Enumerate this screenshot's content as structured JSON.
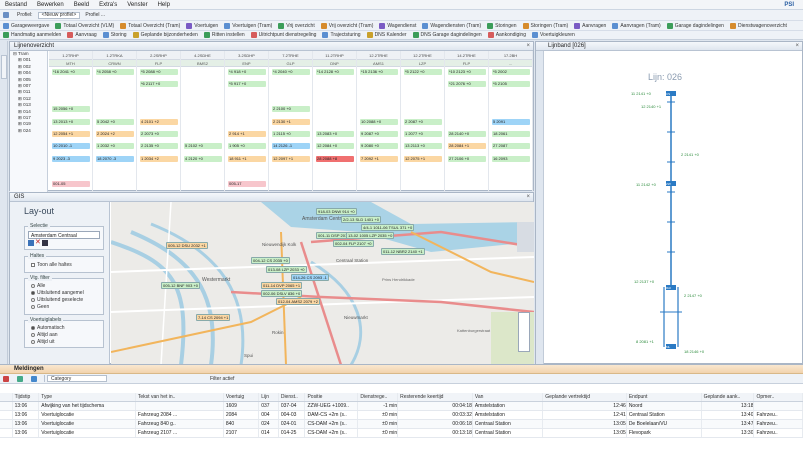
{
  "menu": {
    "items": [
      "Bestand",
      "Bewerken",
      "Beeld",
      "Extra's",
      "Venster",
      "Help"
    ],
    "brand": "PSI"
  },
  "toolbar1": {
    "profiel_label": "Profiel:",
    "profiel_value": "<Nieuw profiel>",
    "profiel2": "Profiel ..."
  },
  "toolbar2": [
    "Garageweergave",
    "Totaal Overzicht (VLM)",
    "Totaal Overzicht (Tram)",
    "Voertuigen",
    "Voertuigen (Tram)",
    "Vrij overzicht",
    "Vrij overzicht (Tram)",
    "Wagendienst",
    "Wagendiensten (Tram)",
    "Storingen",
    "Storingen (Tram)",
    "Aanvragen",
    "Aanvragen (Tram)",
    "Garage dagindelingen",
    "Dienstwagenoverzicht"
  ],
  "toolbar3": [
    "Handmatig aanmelden",
    "Aanvraag",
    "Storing",
    "Geplande bijzonderheden",
    "Ritten instellen",
    "Uitrichtpunt dienstregeling",
    "Trajectsturing",
    "DNS Kalender",
    "DNS Garage dagindelingen",
    "Aankondiging",
    "Voertuigkleuren"
  ],
  "lijnen": {
    "title": "Lijnenoverzicht",
    "tree": [
      "Tram",
      "001",
      "002",
      "004",
      "005",
      "007",
      "011",
      "012",
      "013",
      "014",
      "017",
      "019",
      "024"
    ],
    "columns": [
      {
        "head": "1.2TRHP",
        "sub": "MTH"
      },
      {
        "head": "1.2TRKA",
        "sub": "CRWN"
      },
      {
        "head": "2.2SRHP",
        "sub": "FLP"
      },
      {
        "head": "4.2SDHE",
        "sub": "BMS2"
      },
      {
        "head": "3.2SDHP",
        "sub": "ENP"
      },
      {
        "head": "7.2TRHE",
        "sub": "GLP"
      },
      {
        "head": "11.2TRHP",
        "sub": "DNP"
      },
      {
        "head": "12.2TRHE",
        "sub": "AMS1"
      },
      {
        "head": "12.2TRHE",
        "sub": "LZP"
      },
      {
        "head": "14.2TRHE",
        "sub": "FLP"
      },
      {
        "head": "17.2BH",
        "sub": "..."
      }
    ],
    "cells": [
      {
        "c": 0,
        "r": 0,
        "t": "*16 2041 +0",
        "k": "g"
      },
      {
        "c": 1,
        "r": 0,
        "t": "*4 2058 +0",
        "k": "g"
      },
      {
        "c": 2,
        "r": 0,
        "t": "*5 2088 +0",
        "k": "g"
      },
      {
        "c": 4,
        "r": 0,
        "t": "*4 918 +0",
        "k": "g"
      },
      {
        "c": 5,
        "r": 0,
        "t": "*4 2040 +0",
        "k": "g"
      },
      {
        "c": 6,
        "r": 0,
        "t": "*14 2128 +0",
        "k": "g"
      },
      {
        "c": 7,
        "r": 0,
        "t": "*15 2136 +0",
        "k": "g"
      },
      {
        "c": 8,
        "r": 0,
        "t": "*5 2122 +0",
        "k": "g"
      },
      {
        "c": 9,
        "r": 0,
        "t": "*10 2123 +0",
        "k": "g"
      },
      {
        "c": 10,
        "r": 0,
        "t": "*5 2002",
        "k": "g"
      },
      {
        "c": 2,
        "r": 1,
        "t": "*6 2117 +0",
        "k": "g"
      },
      {
        "c": 4,
        "r": 1,
        "t": "*5 917 +0",
        "k": "g"
      },
      {
        "c": 9,
        "r": 1,
        "t": "*21 2076 +0",
        "k": "g"
      },
      {
        "c": 10,
        "r": 1,
        "t": "*5 2105",
        "k": "g"
      },
      {
        "c": 0,
        "r": 3,
        "t": "15 2056 +0",
        "k": "g"
      },
      {
        "c": 5,
        "r": 3,
        "t": "2 2100 +0",
        "k": "g"
      },
      {
        "c": 0,
        "r": 4,
        "t": "13 2013 +0",
        "k": "g"
      },
      {
        "c": 1,
        "r": 4,
        "t": "5 2042 +0",
        "k": "g"
      },
      {
        "c": 2,
        "r": 4,
        "t": "4 2101 +2",
        "k": "o"
      },
      {
        "c": 5,
        "r": 4,
        "t": "2 2130 +1",
        "k": "o"
      },
      {
        "c": 7,
        "r": 4,
        "t": "10 2088 +0",
        "k": "g"
      },
      {
        "c": 8,
        "r": 4,
        "t": "2 2087 +0",
        "k": "g"
      },
      {
        "c": 10,
        "r": 4,
        "t": "5 2091",
        "k": "b"
      },
      {
        "c": 0,
        "r": 5,
        "t": "12 2054 +1",
        "k": "o"
      },
      {
        "c": 1,
        "r": 5,
        "t": "2 2024 +2",
        "k": "o"
      },
      {
        "c": 2,
        "r": 5,
        "t": "2 2073 +0",
        "k": "g"
      },
      {
        "c": 4,
        "r": 5,
        "t": "2 914 +1",
        "k": "o"
      },
      {
        "c": 5,
        "r": 5,
        "t": "1 2115 +0",
        "k": "g"
      },
      {
        "c": 6,
        "r": 5,
        "t": "13 2083 +0",
        "k": "g"
      },
      {
        "c": 7,
        "r": 5,
        "t": "9 2087 +0",
        "k": "g"
      },
      {
        "c": 8,
        "r": 5,
        "t": "1 2077 +0",
        "k": "g"
      },
      {
        "c": 9,
        "r": 5,
        "t": "28 2140 +0",
        "k": "g"
      },
      {
        "c": 10,
        "r": 5,
        "t": "18 2061",
        "k": "g"
      },
      {
        "c": 0,
        "r": 6,
        "t": "10 2010 -1",
        "k": "b"
      },
      {
        "c": 1,
        "r": 6,
        "t": "1 2032 +0",
        "k": "g"
      },
      {
        "c": 2,
        "r": 6,
        "t": "2 2135 +0",
        "k": "g"
      },
      {
        "c": 3,
        "r": 6,
        "t": "5 2102 +0",
        "k": "g"
      },
      {
        "c": 4,
        "r": 6,
        "t": "1 905 +0",
        "k": "g"
      },
      {
        "c": 5,
        "r": 6,
        "t": "14 2126 -1",
        "k": "b"
      },
      {
        "c": 6,
        "r": 6,
        "t": "12 2084 +0",
        "k": "g"
      },
      {
        "c": 7,
        "r": 6,
        "t": "9 2080 +0",
        "k": "g"
      },
      {
        "c": 8,
        "r": 6,
        "t": "13 2113 +0",
        "k": "g"
      },
      {
        "c": 9,
        "r": 6,
        "t": "28 2084 +1",
        "k": "o"
      },
      {
        "c": 10,
        "r": 6,
        "t": "27 2087",
        "k": "g"
      },
      {
        "c": 0,
        "r": 7,
        "t": "9 2023 -3",
        "k": "b"
      },
      {
        "c": 1,
        "r": 7,
        "t": "18 2070 -3",
        "k": "b"
      },
      {
        "c": 2,
        "r": 7,
        "t": "1 2034 +2",
        "k": "o"
      },
      {
        "c": 3,
        "r": 7,
        "t": "4 2120 +0",
        "k": "g"
      },
      {
        "c": 4,
        "r": 7,
        "t": "18 911 +1",
        "k": "o"
      },
      {
        "c": 5,
        "r": 7,
        "t": "12 2097 +1",
        "k": "o"
      },
      {
        "c": 6,
        "r": 7,
        "t": "28 2088 +8",
        "k": "r"
      },
      {
        "c": 7,
        "r": 7,
        "t": "7 2092 +1",
        "k": "o"
      },
      {
        "c": 8,
        "r": 7,
        "t": "12 2075 +1",
        "k": "o"
      },
      {
        "c": 9,
        "r": 7,
        "t": "27 2106 +0",
        "k": "g"
      },
      {
        "c": 10,
        "r": 7,
        "t": "16 2093",
        "k": "g"
      },
      {
        "c": 0,
        "r": 9,
        "t": "001-05",
        "k": "p"
      },
      {
        "c": 4,
        "r": 9,
        "t": "005-17",
        "k": "p"
      }
    ]
  },
  "gis": {
    "tab": "GIS",
    "layout_title": "Lay-out",
    "selectie_label": "Selectie",
    "selectie_value": "Amsterdam Centraal",
    "haltes_label": "Haltes",
    "toon_alle": "Toon alle haltes",
    "vtg_filter_label": "Vtg. filter",
    "filter_opts": [
      "Alle",
      "Uitsluitend aangemel",
      "Uitsluitend geselecte",
      "Geen"
    ],
    "voertuiglabels_label": "Voertuiglabels",
    "label_opts": [
      "Automatisch",
      "Altijd aan",
      "Altijd uit"
    ],
    "map_labels": [
      "Amsterdam Centraal",
      "Nieuwmarkt",
      "Westermarkt",
      "Dam",
      "Rokin",
      "Spui",
      "Nieuwendijk Kolk",
      "Centraal Station",
      "Prins Hendrikkade",
      "Kattenburgerstraat"
    ],
    "vehicle_tags": [
      "918-03 DNW 914 +0",
      "2/2-13 SLD 1401 +0",
      "4/4-1 1011-06 TSUL 371 +0",
      "001-11 DSP 2017 +0",
      "13-02 1005 LZP 2035 +0",
      "002-04 FLP 2107 +0",
      "011-12 NBR2 2140 +1",
      "005-12 DSU 2032 +1",
      "005-12 BNF 903 +0",
      "013-08 LZP 2033 +0",
      "014-26 CS 2093 -1",
      "011-14 DVP 2065 +1",
      "002-06 DSLV 836 +0",
      "012-04 AMS2 2079 +2",
      "7-14 CS 2094 +1",
      "004-12 CS 2035 +0"
    ]
  },
  "lijnband": {
    "tab": "Lijnband [026]",
    "title": "Lijn: 026",
    "stops_top": [
      "11 2141 +0",
      "12 2140 +1",
      "2 2141 +0",
      "11 2142 +0"
    ],
    "stops_mid": [
      "12 2137 +0",
      "2 2147 +0"
    ],
    "stops_bot": [
      "8 2081 +1",
      "18 2146 +0"
    ],
    "stop_codes": [
      "CS",
      "ZW",
      "RAI",
      "ML"
    ]
  },
  "meldingen": {
    "tab": "Meldingen",
    "filter_label": "Filter actief",
    "category": "Category",
    "columns": [
      "Tijdstip",
      "Type",
      "Tekst van het in..",
      "Voertuig",
      "Lijn",
      "Dienst..",
      "Positie",
      "Dienstrege..",
      "Resterende keertijd",
      "Van",
      "Geplande vertrektijd",
      "Endpunt",
      "Geplande aank..",
      "Opmer.."
    ],
    "rows": [
      [
        "13:06",
        "Afwijking van het tijdschema",
        "",
        "1609",
        "037",
        "037-04",
        "ZZW-UEG +1009..",
        "-1 min",
        "00:04:18",
        "Amstelstation",
        "12:46",
        "Noord",
        "13:18",
        ""
      ],
      [
        "13:06",
        "Voertuiglocatie",
        "Fahrzeug 2084 ...",
        "2084",
        "004",
        "004-03",
        "DAM-CS +2m (s..",
        "±0 min",
        "00:03:32",
        "Amstelstation",
        "12:41",
        "Centraal Station",
        "13:40",
        "Fahrzeu.."
      ],
      [
        "13:06",
        "Voertuiglocatie",
        "Fahrzeug 840 g..",
        "840",
        "024",
        "024-01",
        "CS-DAM +2m (s..",
        "±0 min",
        "00:06:18",
        "Centraal Station",
        "13:05",
        "De Boelelaan/VU",
        "13:47",
        "Fahrzeu.."
      ],
      [
        "13:06",
        "Voertuiglocatie",
        "Fahrzeug 2107 ...",
        "2107",
        "014",
        "014-25",
        "CS-DAM +2m (s..",
        "±0 min",
        "00:13:18",
        "Centraal Station",
        "13:05",
        "Flevopark",
        "13:30",
        "Fahrzeu.."
      ]
    ]
  },
  "colors": {
    "green": "#c9efc8",
    "orange": "#fbd7a3",
    "blue": "#9ed4f7",
    "red": "#f07070",
    "pink": "#f7c6cc",
    "accent": "#2a7ac4"
  }
}
